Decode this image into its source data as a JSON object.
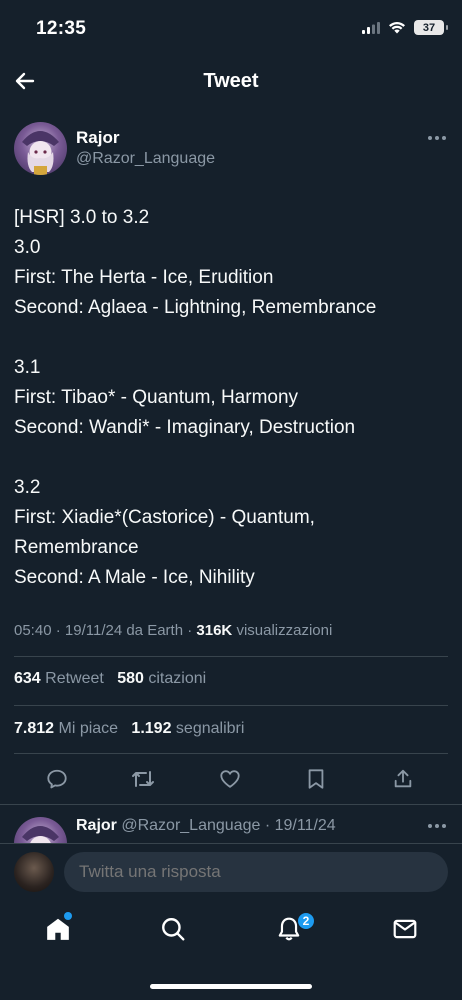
{
  "status": {
    "time": "12:35",
    "battery": "37"
  },
  "header": {
    "title": "Tweet"
  },
  "author": {
    "name": "Rajor",
    "handle": "@Razor_Language"
  },
  "tweet": {
    "lines": [
      "[HSR] 3.0 to 3.2",
      "3.0",
      "First: The Herta - Ice, Erudition",
      "Second: Aglaea - Lightning, Remembrance",
      "",
      "3.1",
      "First: Tibao* - Quantum, Harmony",
      "Second: Wandi* - Imaginary, Destruction",
      "",
      "3.2",
      "First: Xiadie*(Castorice) - Quantum,",
      "Remembrance",
      "Second: A Male - Ice, Nihility"
    ]
  },
  "meta": {
    "time": "05:40",
    "date": "19/11/24",
    "source": "da Earth",
    "views": "316K",
    "views_label": "visualizzazioni"
  },
  "stats": {
    "retweets": "634",
    "retweets_label": "Retweet",
    "quotes": "580",
    "quotes_label": "citazioni",
    "likes": "7.812",
    "likes_label": "Mi piace",
    "bookmarks": "1.192",
    "bookmarks_label": "segnalibri"
  },
  "reply_preview": {
    "name": "Rajor",
    "handle_date": "@Razor_Language · 19/11/24"
  },
  "compose": {
    "placeholder": "Twitta una risposta"
  },
  "tabs": {
    "notifications_count": "2"
  },
  "icons": [
    "back-arrow-icon",
    "more-icon",
    "reply-icon",
    "retweet-icon",
    "like-icon",
    "bookmark-icon",
    "share-icon",
    "home-icon",
    "search-icon",
    "bell-icon",
    "mail-icon"
  ],
  "colors": {
    "background": "#15202b",
    "accent": "#1d9bf0",
    "secondary_text": "#8b98a5",
    "divider": "#38444d"
  }
}
